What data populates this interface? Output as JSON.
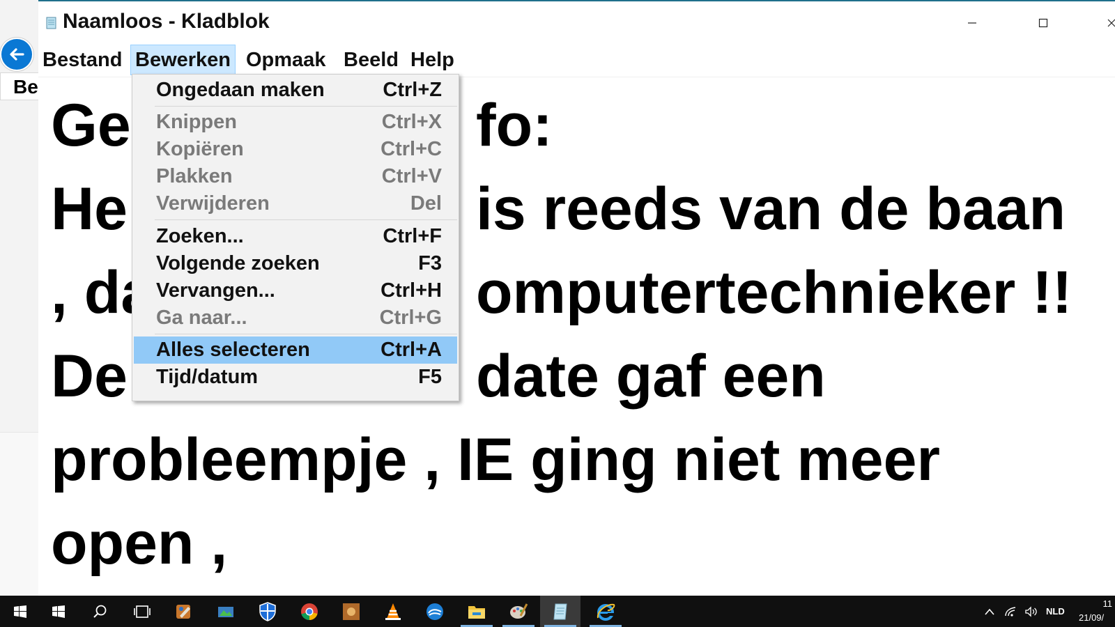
{
  "background_window": {
    "tab_label": "Be"
  },
  "window": {
    "title": "Naamloos - Kladblok"
  },
  "menubar": {
    "items": [
      "Bestand",
      "Bewerken",
      "Opmaak",
      "Beeld",
      "Help"
    ],
    "active": "Bewerken"
  },
  "editor": {
    "lines": [
      "Ge",
      "He",
      ", da",
      "De",
      "probleempje , IE ging niet meer",
      "open ,"
    ],
    "lines_right": [
      "fo:",
      "is reeds van de baan",
      "omputertechnieker !!",
      "date gaf een",
      "",
      ""
    ]
  },
  "edit_menu": {
    "items": [
      {
        "label": "Ongedaan maken",
        "shortcut": "Ctrl+Z",
        "enabled": true
      },
      {
        "label": "Knippen",
        "shortcut": "Ctrl+X",
        "enabled": false
      },
      {
        "label": "Kopiëren",
        "shortcut": "Ctrl+C",
        "enabled": false
      },
      {
        "label": "Plakken",
        "shortcut": "Ctrl+V",
        "enabled": false
      },
      {
        "label": "Verwijderen",
        "shortcut": "Del",
        "enabled": false
      },
      {
        "label": "Zoeken...",
        "shortcut": "Ctrl+F",
        "enabled": true
      },
      {
        "label": "Volgende zoeken",
        "shortcut": "F3",
        "enabled": true
      },
      {
        "label": "Vervangen...",
        "shortcut": "Ctrl+H",
        "enabled": true
      },
      {
        "label": "Ga naar...",
        "shortcut": "Ctrl+G",
        "enabled": false
      },
      {
        "label": "Alles selecteren",
        "shortcut": "Ctrl+A",
        "enabled": true,
        "highlighted": true
      },
      {
        "label": "Tijd/datum",
        "shortcut": "F5",
        "enabled": true
      }
    ]
  },
  "taskbar": {
    "apps": [
      "start-icon",
      "windows-logo-icon",
      "search-icon",
      "task-view-icon",
      "paint-tool-icon",
      "photo-viewer-icon",
      "security-shield-icon",
      "chrome-icon",
      "media-app-icon",
      "vlc-icon",
      "cloud-app-icon",
      "file-explorer-icon",
      "paint-icon",
      "notepad-icon",
      "internet-explorer-icon"
    ],
    "language": "NLD",
    "clock_time": "11",
    "clock_date": "21/09/"
  },
  "colors": {
    "accent": "#0a78d4",
    "menu_highlight": "#91c9f7",
    "menubar_active": "#cce8ff",
    "taskbar": "#101010"
  }
}
